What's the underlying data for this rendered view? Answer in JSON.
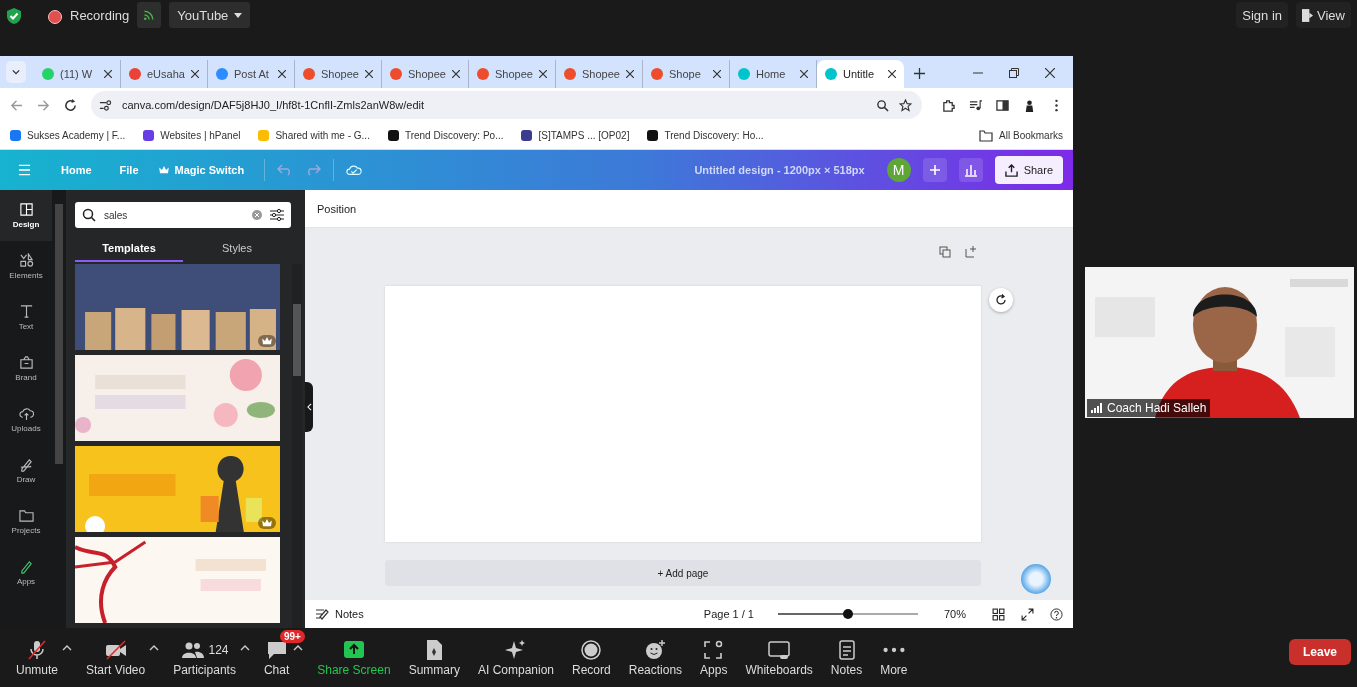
{
  "meeting_top": {
    "recording": "Recording",
    "stream": "YouTube",
    "sign_in": "Sign in",
    "view": "View"
  },
  "browser": {
    "tabs": [
      {
        "title": "(11) W",
        "selected": false
      },
      {
        "title": "eUsaha",
        "selected": false
      },
      {
        "title": "Post At",
        "selected": false
      },
      {
        "title": "Shopee",
        "selected": false
      },
      {
        "title": "Shopee",
        "selected": false
      },
      {
        "title": "Shopee",
        "selected": false
      },
      {
        "title": "Shopee",
        "selected": false
      },
      {
        "title": "Shope",
        "selected": false
      },
      {
        "title": "Home",
        "selected": false
      },
      {
        "title": "Untitle",
        "selected": true
      }
    ],
    "url": "canva.com/design/DAF5j8HJ0_I/hf8t-1CnflI-Zmls2anW8w/edit",
    "bookmarks": [
      "Sukses Academy | F...",
      "Websites | hPanel",
      "Shared with me - G...",
      "Trend Discovery: Po...",
      "[S]TAMPS ... [OP02]",
      "Trend Discovery: Ho..."
    ],
    "all_bookmarks": "All Bookmarks"
  },
  "canva": {
    "menu": [
      "Home",
      "File",
      "Magic Switch"
    ],
    "title": "Untitled design - 1200px × 518px",
    "avatar": "M",
    "share": "Share",
    "rail": [
      {
        "label": "Design",
        "selected": true
      },
      {
        "label": "Elements",
        "selected": false
      },
      {
        "label": "Text",
        "selected": false
      },
      {
        "label": "Brand",
        "selected": false
      },
      {
        "label": "Uploads",
        "selected": false
      },
      {
        "label": "Draw",
        "selected": false
      },
      {
        "label": "Projects",
        "selected": false
      },
      {
        "label": "Apps",
        "selected": false
      }
    ],
    "search": {
      "value": "sales"
    },
    "panel_tabs": [
      {
        "label": "Templates",
        "selected": true
      },
      {
        "label": "Styles",
        "selected": false
      }
    ],
    "templates": [
      {
        "kind": "picture",
        "premium": true
      },
      {
        "kind": "picture",
        "premium": false
      },
      {
        "kind": "picture",
        "premium": true
      },
      {
        "kind": "picture",
        "premium": false
      }
    ],
    "toolbar": "Position",
    "add_page": "+ Add page",
    "notes": "Notes",
    "page": "Page 1 / 1",
    "zoom": {
      "level": 0.5,
      "reading": "70%"
    }
  },
  "video": {
    "name": "Coach Hadi Salleh"
  },
  "controls": [
    {
      "label": "Unmute",
      "kind": "mic",
      "caret": true
    },
    {
      "label": "Start Video",
      "kind": "camera",
      "caret": true
    },
    {
      "label": "Participants",
      "kind": "people",
      "count": "124",
      "caret": true
    },
    {
      "label": "Chat",
      "kind": "chat",
      "badge": "99+",
      "caret": true
    },
    {
      "label": "Share Screen",
      "kind": "share",
      "caret": false
    },
    {
      "label": "Summary",
      "kind": "summary",
      "caret": false
    },
    {
      "label": "AI Companion",
      "kind": "sparkle",
      "caret": false
    },
    {
      "label": "Record",
      "kind": "record",
      "caret": false
    },
    {
      "label": "Reactions",
      "kind": "smile",
      "caret": false
    },
    {
      "label": "Apps",
      "kind": "apps",
      "caret": false
    },
    {
      "label": "Whiteboards",
      "kind": "board",
      "caret": false
    },
    {
      "label": "Notes",
      "kind": "notes",
      "caret": false
    },
    {
      "label": "More",
      "kind": "more",
      "caret": false
    }
  ],
  "leave": "Leave"
}
